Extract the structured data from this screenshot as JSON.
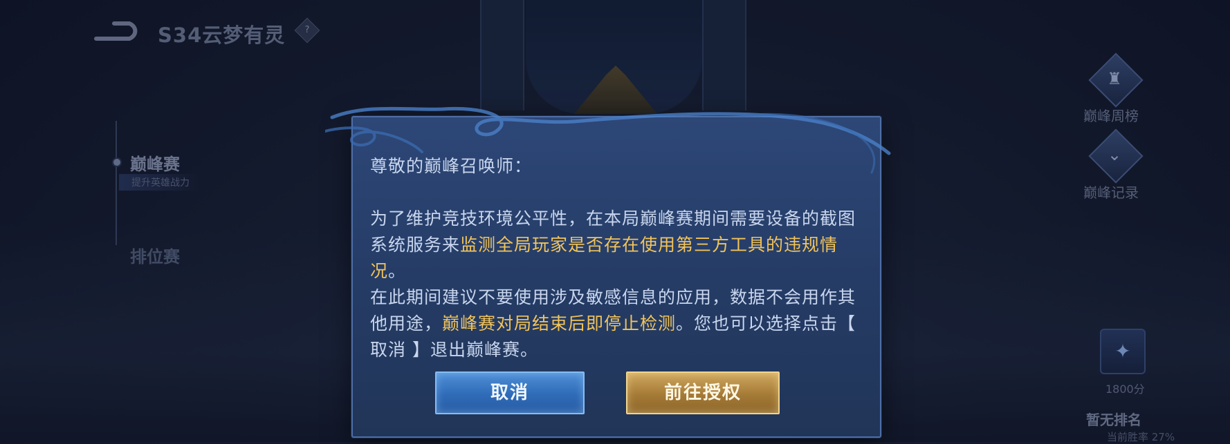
{
  "header": {
    "season_title": "S34云梦有灵",
    "season_info_glyph": "?"
  },
  "left_menu": {
    "active_mode": "巅峰赛",
    "active_mode_sub": "提升英雄战力",
    "other_mode": "排位赛"
  },
  "right_panel": {
    "weekly_label": "巅峰周榜",
    "records_label": "巅峰记录",
    "points": "1800分",
    "rank_status": "暂无排名",
    "win_rate": "当前胜率 27%"
  },
  "dialog": {
    "greeting": "尊敬的巅峰召唤师：",
    "para1_a": "为了维护竞技环境公平性，在本局巅峰赛期间需要设备的截图系统服务来",
    "para1_hl": "监测全局玩家是否存在使用第三方工具的违规情况",
    "para1_b": "。",
    "para2_a": "在此期间建议不要使用涉及敏感信息的应用，数据不会用作其他用途，",
    "para2_hl": "巅峰赛对局结束后即停止检测",
    "para2_b": "。您也可以选择点击【 取消 】退出巅峰赛。",
    "cancel_label": "取消",
    "authorize_label": "前往授权"
  },
  "colors": {
    "highlight": "#f2c45a",
    "dialog_bg": "#253c66",
    "cancel_btn": "#3a7ac4",
    "authorize_btn": "#b08a44"
  },
  "icons": [
    "back-arrow-icon",
    "info-diamond-icon",
    "weekly-ranking-icon",
    "records-icon",
    "rank-badge-icon"
  ]
}
